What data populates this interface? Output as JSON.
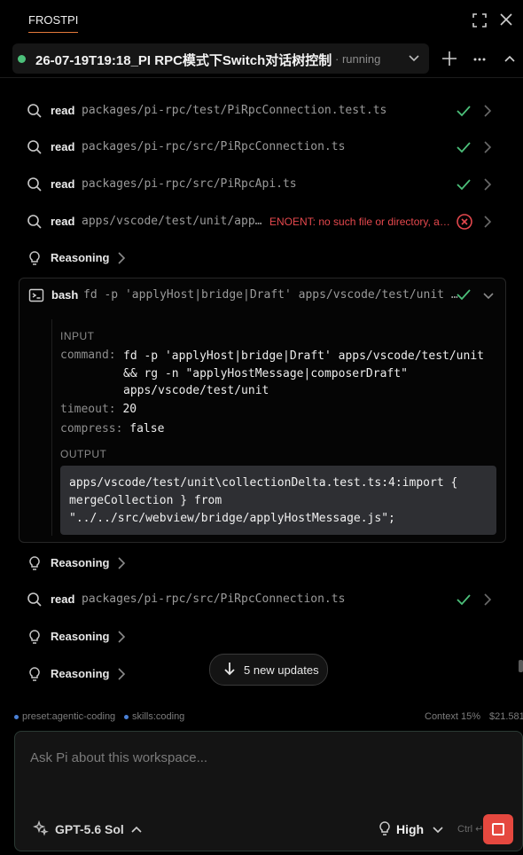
{
  "app": {
    "tab": "FROSTPI"
  },
  "session": {
    "title": "26-07-19T19:18_PI RPC模式下Switch对话树控制",
    "status": "· running",
    "status_color": "#4cc07a"
  },
  "rows": {
    "r1": {
      "kw": "read",
      "path": "packages/pi-rpc/test/PiRpcConnection.test.ts"
    },
    "r2": {
      "kw": "read",
      "path": "packages/pi-rpc/src/PiRpcConnection.ts"
    },
    "r3": {
      "kw": "read",
      "path": "packages/pi-rpc/src/PiRpcApi.ts"
    },
    "r4": {
      "kw": "read",
      "path": "apps/vscode/test/unit/app…",
      "error": "ENOENT: no such file or directory, a…"
    },
    "r5": {
      "label": "Reasoning"
    },
    "r6": {
      "label": "Reasoning"
    },
    "r7": {
      "kw": "read",
      "path": "packages/pi-rpc/src/PiRpcConnection.ts"
    },
    "r8": {
      "label": "Reasoning"
    },
    "r9": {
      "label": "Reasoning"
    }
  },
  "bash": {
    "kw": "bash",
    "summary": "fd -p 'applyHost|bridge|Draft' apps/vscode/test/unit …",
    "input_label": "INPUT",
    "command_key": "command:",
    "command_lines": [
      "fd -p 'applyHost|bridge|Draft' apps/vscode/test/unit",
      "&& rg -n \"applyHostMessage|composerDraft\"",
      "apps/vscode/test/unit"
    ],
    "timeout_key": "timeout:",
    "timeout_val": "20",
    "compress_key": "compress:",
    "compress_val": "false",
    "output_label": "OUTPUT",
    "output_lines": [
      "apps/vscode/test/unit\\collectionDelta.test.ts:4:import {",
      "mergeCollection } from",
      "\"../../src/webview/bridge/applyHostMessage.js\";"
    ]
  },
  "updates": {
    "label": "5 new updates"
  },
  "statusline": {
    "preset": "preset:agentic-coding",
    "skills": "skills:coding",
    "context": "Context 15%",
    "cost": "$21.581"
  },
  "composer": {
    "placeholder": "Ask Pi about this workspace...",
    "model": "GPT-5.6 Sol",
    "thinking": "High",
    "hint": "Ctrl ↵"
  },
  "colors": {
    "accent": "#e47a3a",
    "success": "#4cc07a",
    "error": "#e5484d",
    "stop": "#e5483f"
  }
}
